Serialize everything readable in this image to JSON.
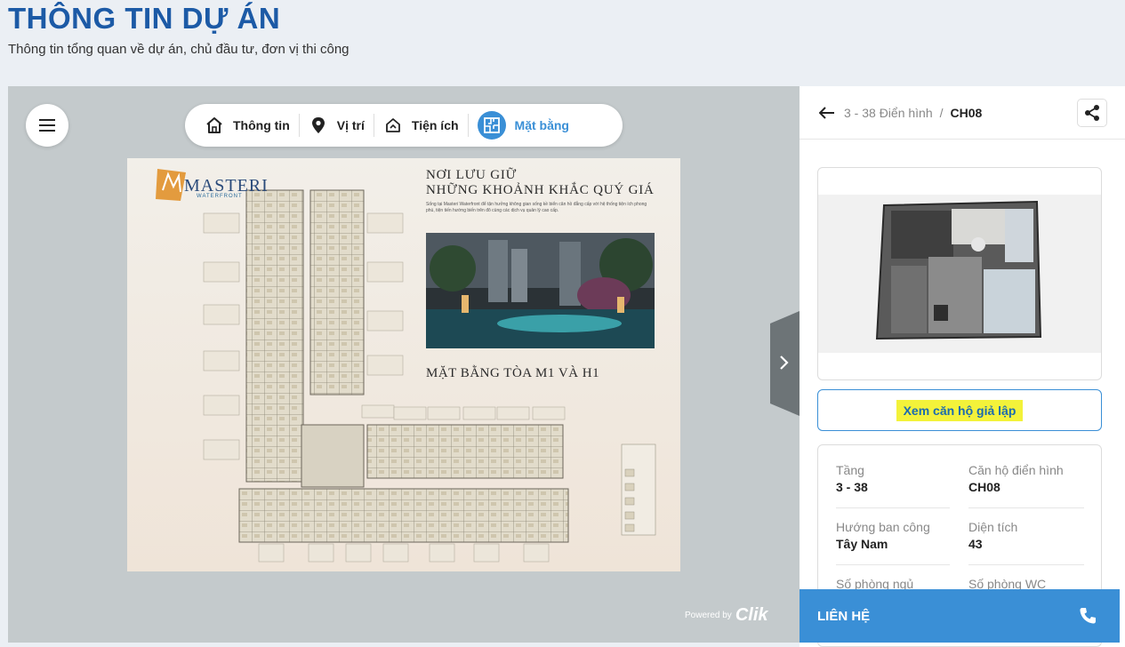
{
  "page": {
    "title": "THÔNG TIN DỰ ÁN",
    "subtitle": "Thông tin tổng quan về dự án, chủ đầu tư, đơn vị thi công"
  },
  "viewer": {
    "menu_icon": "hamburger-menu-icon",
    "tabs": [
      {
        "label": "Thông tin",
        "icon": "home-icon",
        "active": false
      },
      {
        "label": "Vị trí",
        "icon": "location-pin-icon",
        "active": false
      },
      {
        "label": "Tiện ích",
        "icon": "amenity-house-icon",
        "active": false
      },
      {
        "label": "Mặt bằng",
        "icon": "floorplan-icon",
        "active": true
      }
    ],
    "floorplan": {
      "logo_name": "MASTERI",
      "logo_tagline": "WATERFRONT",
      "heading_line1": "NƠI LƯU GIỮ",
      "heading_line2": "NHỮNG KHOẢNH KHẮC QUÝ GIÁ",
      "body": "Sống tại Masteri Waterfront để tận hưởng không gian sống kề biển cân hồ đẳng cấp với hệ thống tiện ích phong phú, tiện tiến hướng biến trên đô cùng các dịch vụ quản lý cao cấp.",
      "caption": "MẶT BẰNG TÒA M1 VÀ H1"
    },
    "powered_by": "Powered by",
    "powered_brand": "Clik"
  },
  "panel": {
    "breadcrumb_parent": "3 - 38 Điển hình",
    "breadcrumb_sep": "/",
    "breadcrumb_current": "CH08",
    "simulate_label": "Xem căn hộ giả lập",
    "details": [
      {
        "label": "Tầng",
        "value": "3 - 38"
      },
      {
        "label": "Căn hộ điển hình",
        "value": "CH08"
      },
      {
        "label": "Hướng ban công",
        "value": "Tây Nam"
      },
      {
        "label": "Diện tích",
        "value": "43"
      },
      {
        "label": "Số phòng ngủ",
        "value": ""
      },
      {
        "label": "Số phòng WC",
        "value": ""
      }
    ]
  },
  "contact": {
    "label": "LIÊN HỆ",
    "icon": "phone-icon"
  },
  "colors": {
    "brand_blue": "#1c5aa6",
    "accent_blue": "#3a8fd6",
    "highlight": "#f3f23a"
  }
}
